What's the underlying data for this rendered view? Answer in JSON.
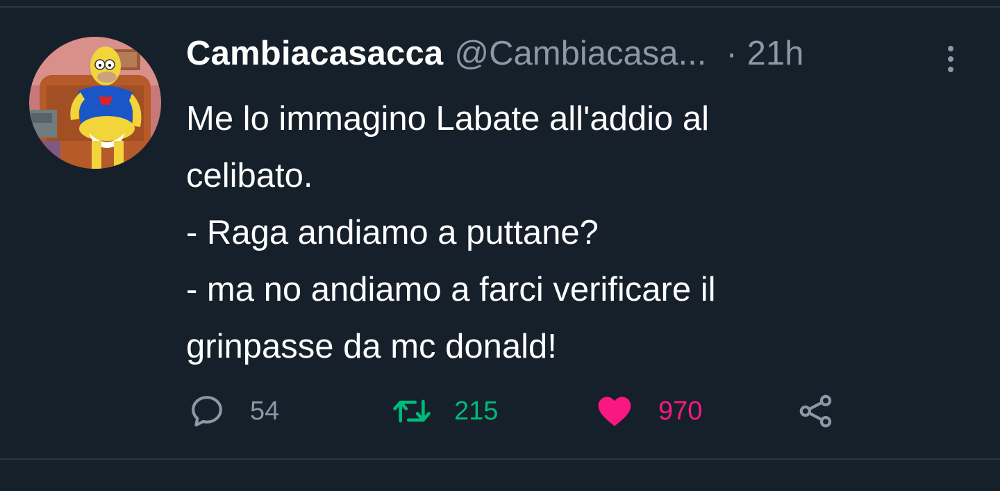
{
  "tweet": {
    "display_name": "Cambiacasacca",
    "handle": "@Cambiacasa...",
    "separator": "·",
    "time": "21h",
    "text_lines": [
      "Me lo immagino Labate all'addio al",
      "celibato.",
      "- Raga andiamo a puttane?",
      "- ma no andiamo a farci verificare il",
      "grinpasse da mc donald!"
    ]
  },
  "actions": {
    "reply_count": "54",
    "retweet_count": "215",
    "like_count": "970",
    "reply_icon": "reply-icon",
    "retweet_icon": "retweet-icon",
    "like_icon": "heart-icon",
    "share_icon": "share-icon"
  },
  "colors": {
    "background": "#15202b",
    "secondary_text": "#8b98a5",
    "retweet": "#00ba7c",
    "like": "#f91880"
  }
}
